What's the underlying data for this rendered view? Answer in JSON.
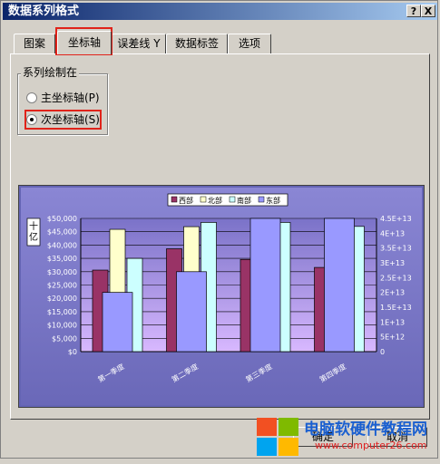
{
  "window": {
    "title": "数据系列格式",
    "help_label": "?",
    "close_label": "X"
  },
  "tabs": [
    {
      "label": "图案"
    },
    {
      "label": "坐标轴"
    },
    {
      "label": "误差线 Y"
    },
    {
      "label": "数据标签"
    },
    {
      "label": "选项"
    }
  ],
  "active_tab": 1,
  "plot_series_on": {
    "group_title": "系列绘制在",
    "primary_axis_label": "主坐标轴(P)",
    "secondary_axis_label": "次坐标轴(S)",
    "selected": "secondary"
  },
  "buttons": {
    "ok_label": "确定",
    "cancel_label": "取消"
  },
  "watermark": {
    "site_name": "电脑软硬件教程网",
    "site_url": "www.computer26.com"
  },
  "chart_data": {
    "type": "bar",
    "categories": [
      "第一季度",
      "第二季度",
      "第三季度",
      "第四季度"
    ],
    "series": [
      {
        "name": "西部",
        "axis": "primary",
        "values": [
          30600,
          38600,
          34600,
          31600
        ],
        "color": "#993366"
      },
      {
        "name": "北部",
        "axis": "primary",
        "values": [
          45900,
          46900,
          45000,
          0
        ],
        "color": "#ffffcc"
      },
      {
        "name": "南部",
        "axis": "primary",
        "values": [
          35000,
          48500,
          48500,
          47000
        ],
        "color": "#ccffff"
      },
      {
        "name": "东部",
        "axis": "secondary",
        "values": 20000000000000
      },
      {
        "name": "东部",
        "axis": "secondary",
        "values": [
          20000000000000,
          27000000000000,
          45000000000000,
          45000000000000
        ],
        "color": "#9999ff"
      }
    ],
    "y_ticks": [
      "$0",
      "$5,000",
      "$10,000",
      "$15,000",
      "$20,000",
      "$25,000",
      "$30,000",
      "$35,000",
      "$40,000",
      "$45,000",
      "$50,000"
    ],
    "y2_ticks": [
      "0",
      "5E+12",
      "1E+13",
      "1.5E+13",
      "2E+13",
      "2.5E+13",
      "3E+13",
      "3.5E+13",
      "4E+13",
      "4.5E+13"
    ],
    "ylim": [
      0,
      50000
    ],
    "y2lim": [
      0,
      45000000000000
    ],
    "y_unit_label": "十亿",
    "legend_position": "top",
    "grid": true
  }
}
